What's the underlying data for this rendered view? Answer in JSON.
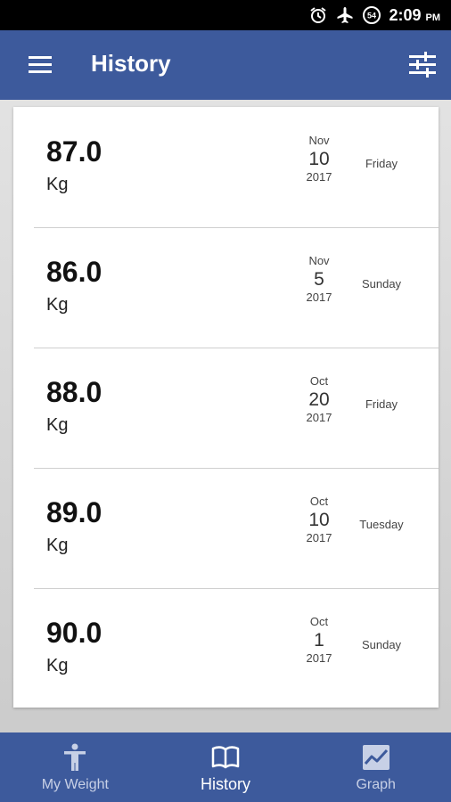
{
  "status_bar": {
    "time": "2:09",
    "ampm": "PM",
    "badge": "54"
  },
  "app_bar": {
    "title": "History"
  },
  "entries": [
    {
      "weight": "87.0",
      "unit": "Kg",
      "month": "Nov",
      "day": "10",
      "year": "2017",
      "weekday": "Friday"
    },
    {
      "weight": "86.0",
      "unit": "Kg",
      "month": "Nov",
      "day": "5",
      "year": "2017",
      "weekday": "Sunday"
    },
    {
      "weight": "88.0",
      "unit": "Kg",
      "month": "Oct",
      "day": "20",
      "year": "2017",
      "weekday": "Friday"
    },
    {
      "weight": "89.0",
      "unit": "Kg",
      "month": "Oct",
      "day": "10",
      "year": "2017",
      "weekday": "Tuesday"
    },
    {
      "weight": "90.0",
      "unit": "Kg",
      "month": "Oct",
      "day": "1",
      "year": "2017",
      "weekday": "Sunday"
    }
  ],
  "bottom_nav": {
    "items": [
      {
        "label": "My Weight",
        "icon": "person-icon"
      },
      {
        "label": "History",
        "icon": "book-icon",
        "active": true
      },
      {
        "label": "Graph",
        "icon": "graph-icon"
      }
    ]
  },
  "colors": {
    "primary": "#3d5a9c"
  }
}
